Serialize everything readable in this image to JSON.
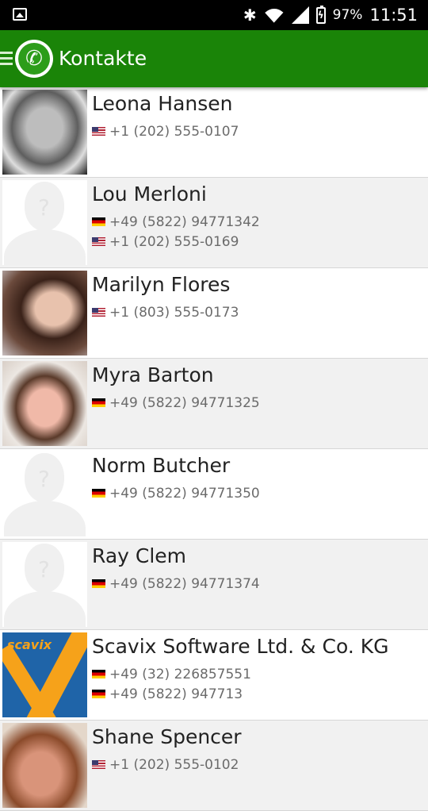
{
  "status_bar": {
    "battery_percent": "97%",
    "time": "11:51",
    "icons": [
      "gallery-icon",
      "bluetooth-icon",
      "wifi-icon",
      "signal-icon",
      "battery-charging-icon"
    ]
  },
  "app_bar": {
    "title": "Kontakte",
    "nav_icon": "hamburger-menu-icon",
    "app_icon": "phone-icon",
    "color": "#1a8408"
  },
  "contacts": [
    {
      "name": "Leona Hansen",
      "avatar": "photo",
      "phones": [
        {
          "flag": "us",
          "number": "+1 (202) 555-0107"
        }
      ]
    },
    {
      "name": "Lou Merloni",
      "avatar": "placeholder",
      "phones": [
        {
          "flag": "de",
          "number": "+49 (5822) 94771342"
        },
        {
          "flag": "us",
          "number": "+1 (202) 555-0169"
        }
      ]
    },
    {
      "name": "Marilyn Flores",
      "avatar": "photo",
      "phones": [
        {
          "flag": "us",
          "number": "+1 (803) 555-0173"
        }
      ]
    },
    {
      "name": "Myra Barton",
      "avatar": "photo",
      "phones": [
        {
          "flag": "de",
          "number": "+49 (5822) 94771325"
        }
      ]
    },
    {
      "name": "Norm Butcher",
      "avatar": "placeholder",
      "phones": [
        {
          "flag": "de",
          "number": "+49 (5822) 94771350"
        }
      ]
    },
    {
      "name": "Ray Clem",
      "avatar": "placeholder",
      "phones": [
        {
          "flag": "de",
          "number": "+49 (5822) 94771374"
        }
      ]
    },
    {
      "name": "Scavix Software Ltd. & Co. KG",
      "avatar": "logo",
      "logo_text": "scavix",
      "phones": [
        {
          "flag": "de",
          "number": "+49 (32) 226857551"
        },
        {
          "flag": "de",
          "number": "+49 (5822) 947713"
        }
      ]
    },
    {
      "name": "Shane Spencer",
      "avatar": "photo",
      "phones": [
        {
          "flag": "us",
          "number": "+1 (202) 555-0102"
        }
      ]
    }
  ]
}
